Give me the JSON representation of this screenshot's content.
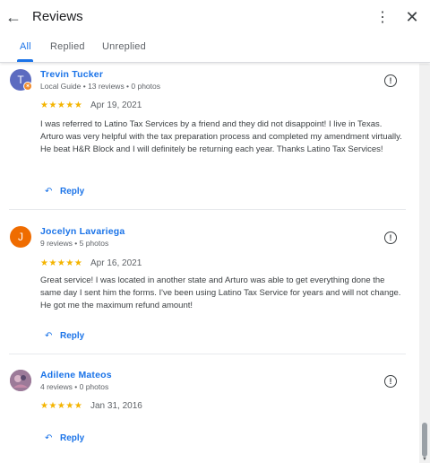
{
  "header": {
    "title": "Reviews",
    "back_icon": "arrow-left-icon",
    "more_icon": "more-vert-icon",
    "close_icon": "close-icon"
  },
  "tabs": [
    {
      "label": "All",
      "active": true
    },
    {
      "label": "Replied",
      "active": false
    },
    {
      "label": "Unreplied",
      "active": false
    }
  ],
  "reviews": [
    {
      "name": "Trevin Tucker",
      "meta": "Local Guide • 13 reviews • 0 photos",
      "avatar_letter": "T",
      "avatar_color": "#5c6bc0",
      "local_guide_badge": true,
      "rating": 5,
      "stars": "★★★★★",
      "date": "Apr 19, 2021",
      "text": "I was referred to Latino Tax Services by a friend and they did not disappoint! I live in Texas. Arturo was very helpful with the tax preparation process and completed my amendment virtually. He beat H&R Block and I will definitely be returning each year. Thanks Latino Tax Services!",
      "reply_label": "Reply"
    },
    {
      "name": "Jocelyn Lavariega",
      "meta": "9 reviews • 5 photos",
      "avatar_letter": "J",
      "avatar_color": "#ef6c00",
      "local_guide_badge": false,
      "rating": 5,
      "stars": "★★★★★",
      "date": "Apr 16, 2021",
      "text": "Great service! I was located in another state and Arturo was able to get everything done the same day I sent him the forms. I've been using Latino Tax Service for years and will not change. He got me the maximum refund amount!",
      "reply_label": "Reply"
    },
    {
      "name": "Adilene Mateos",
      "meta": "4 reviews • 0 photos",
      "avatar_letter": "",
      "avatar_color": "#8e6b8f",
      "local_guide_badge": false,
      "rating": 5,
      "stars": "★★★★★",
      "date": "Jan 31, 2016",
      "text": "",
      "reply_label": "Reply"
    }
  ],
  "colors": {
    "accent": "#1a73e8",
    "star": "#f4b400"
  }
}
